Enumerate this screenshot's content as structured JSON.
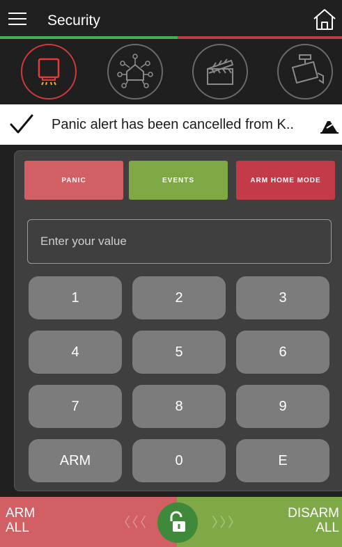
{
  "header": {
    "title": "Security",
    "menu_icon": "hamburger-menu-icon",
    "home_icon": "home-icon"
  },
  "progress": {
    "fraction": 0.52,
    "done_color": "#3fb34f",
    "rest_color": "#c23a44"
  },
  "tabs": [
    {
      "name": "siren-icon",
      "active": true
    },
    {
      "name": "smart-home-network-icon",
      "active": false
    },
    {
      "name": "clapperboard-icon",
      "active": false
    },
    {
      "name": "security-camera-icon",
      "active": false
    }
  ],
  "notification": {
    "text": "Panic alert has been cancelled from K..",
    "check_icon": "check-icon",
    "dismiss_icon": "eraser-icon"
  },
  "actions": {
    "panic": "PANIC",
    "events": "EVENTS",
    "arm_home": "ARM HOME MODE"
  },
  "input": {
    "value": "",
    "placeholder": "Enter your value"
  },
  "keys": [
    "1",
    "2",
    "3",
    "4",
    "5",
    "6",
    "7",
    "8",
    "9",
    "ARM",
    "0",
    "E"
  ],
  "swipe": {
    "left_line1": "ARM",
    "left_line2": "ALL",
    "right_line1": "DISARM",
    "right_line2": "ALL",
    "left_chevrons": "〈〈〈",
    "right_chevrons": "〉〉〉",
    "knob_icon": "unlocked-padlock-icon"
  },
  "colors": {
    "accent_red": "#d15f64",
    "accent_green": "#7ea946",
    "dark_red": "#c33a48",
    "knob_green": "#3e8a3a"
  }
}
